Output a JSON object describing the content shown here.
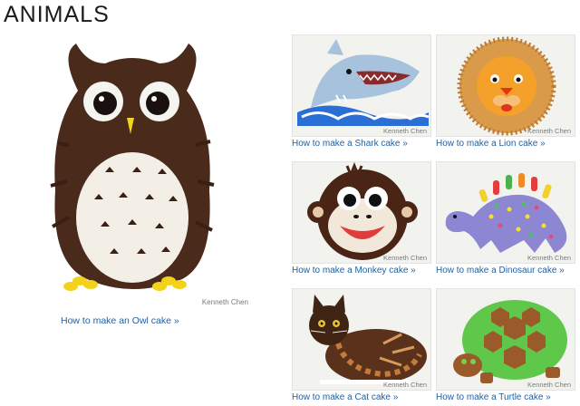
{
  "page": {
    "title": "ANIMALS"
  },
  "feature": {
    "credit": "Kenneth Chen",
    "link": "How to make an Owl cake »",
    "icon": "owl-cake-image"
  },
  "cards": [
    {
      "credit": "Kenneth Chen",
      "link": "How to make a Shark cake »",
      "icon": "shark-cake-image"
    },
    {
      "credit": "Kenneth Chen",
      "link": "How to make a Lion cake »",
      "icon": "lion-cake-image"
    },
    {
      "credit": "Kenneth Chen",
      "link": "How to make a Monkey cake »",
      "icon": "monkey-cake-image"
    },
    {
      "credit": "Kenneth Chen",
      "link": "How to make a Dinosaur cake »",
      "icon": "dinosaur-cake-image"
    },
    {
      "credit": "Kenneth Chen",
      "link": "How to make a Cat cake »",
      "icon": "cat-cake-image"
    },
    {
      "credit": "Kenneth Chen",
      "link": "How to make a Turtle cake »",
      "icon": "turtle-cake-image"
    }
  ],
  "colors": {
    "link": "#1f5f9e",
    "title": "#1a1a1a",
    "credit": "#7a7a7a"
  }
}
